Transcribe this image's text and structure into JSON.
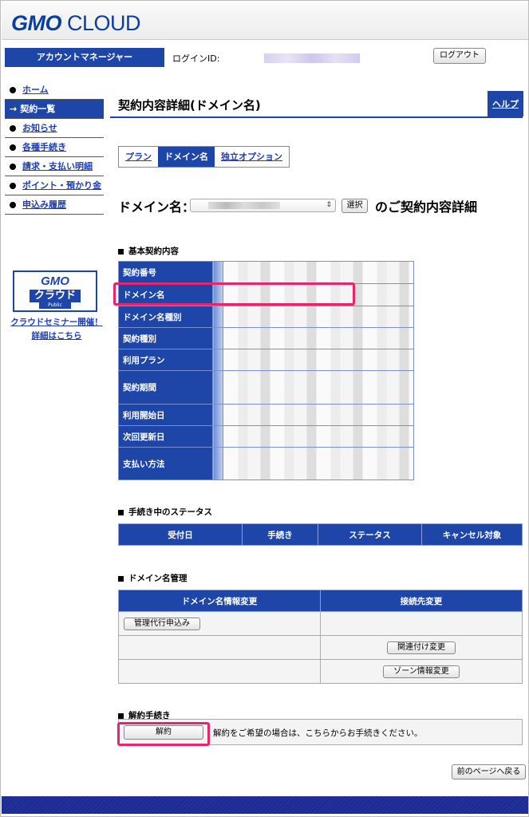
{
  "header": {
    "logo_gmo": "GMO",
    "logo_cloud": "CLOUD",
    "account_manager": "アカウントマネージャー",
    "login_id_label": "ログインID:",
    "logout_label": "ログアウト"
  },
  "sidebar": {
    "items": [
      {
        "label": "ホーム",
        "active": false
      },
      {
        "label": "契約一覧",
        "active": true
      },
      {
        "label": "お知らせ",
        "active": false
      },
      {
        "label": "各種手続き",
        "active": false
      },
      {
        "label": "請求・支払い明細",
        "active": false
      },
      {
        "label": "ポイント・預かり金",
        "active": false
      },
      {
        "label": "申込み履歴",
        "active": false
      }
    ],
    "banner": {
      "line1": "GMO",
      "line2": "クラウド",
      "line3": "Public"
    },
    "banner_link": "クラウドセミナー開催！詳細はこちら"
  },
  "main": {
    "title": "契約内容詳細(ドメイン名)",
    "help_label": "ヘルプ",
    "tabs": [
      {
        "label": "プラン",
        "active": false
      },
      {
        "label": "ドメイン名",
        "active": true
      },
      {
        "label": "独立オプション",
        "active": false
      }
    ],
    "domain_label": "ドメイン名：",
    "select_button": "選択",
    "domain_suffix": "のご契約内容詳細",
    "basic_section": "基本契約内容",
    "basic_rows": [
      "契約番号",
      "ドメイン名",
      "ドメイン名種別",
      "契約種別",
      "利用プラン",
      "契約期間",
      "利用開始日",
      "次回更新日",
      "支払い方法"
    ],
    "status_section": "手続き中のステータス",
    "status_headers": [
      "受付日",
      "手続き",
      "ステータス",
      "キャンセル対象"
    ],
    "mgmt_section": "ドメイン名管理",
    "mgmt_headers": [
      "ドメイン名情報変更",
      "接続先変更"
    ],
    "mgmt_buttons": {
      "proxy": "管理代行申込み",
      "link_change": "関連付け変更",
      "zone_change": "ゾーン情報変更"
    },
    "cancel_section": "解約手続き",
    "cancel_button": "解約",
    "cancel_text": "解約をご希望の場合は、こちらからお手続きください。",
    "back_button": "前のページへ戻る"
  },
  "colors": {
    "accent": "#1e45a8",
    "highlight": "#e5266e",
    "link": "#1f3fb0"
  }
}
